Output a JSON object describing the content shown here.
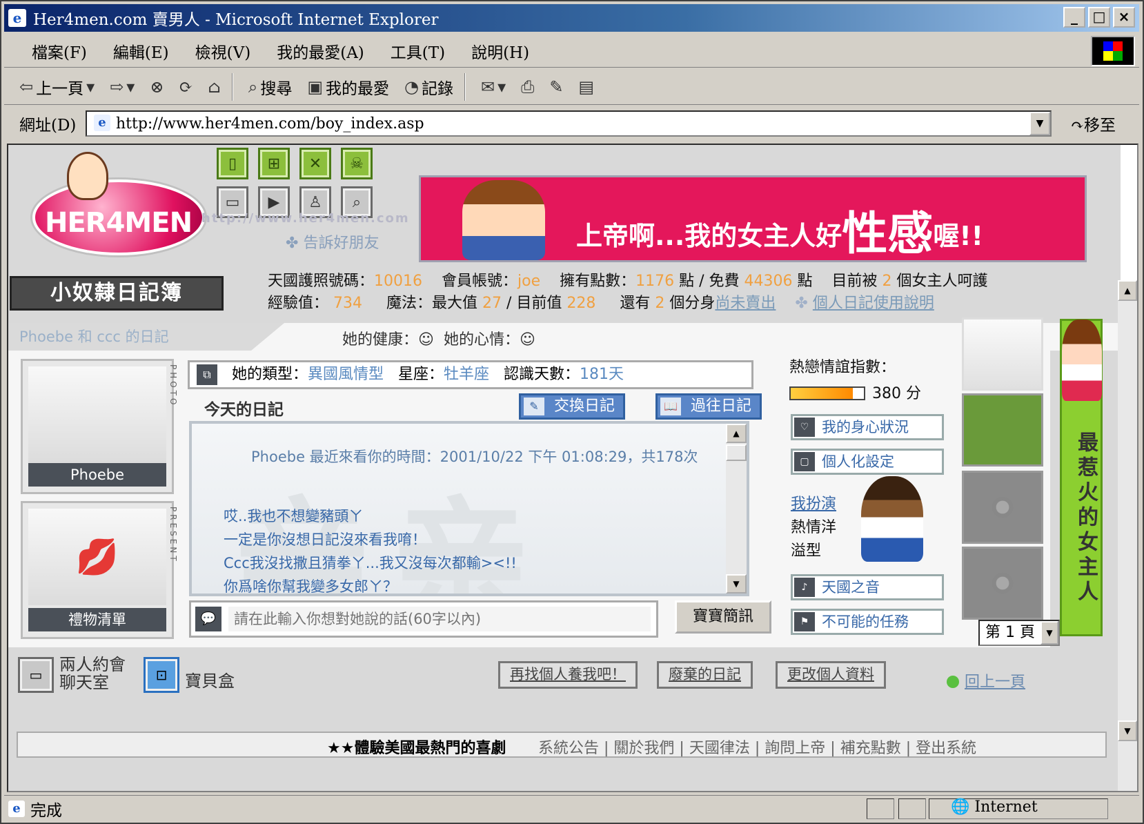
{
  "window": {
    "title": "Her4men.com 賣男人 - Microsoft Internet Explorer",
    "min": "_",
    "max": "□",
    "close": "×"
  },
  "menu": [
    "檔案(F)",
    "編輯(E)",
    "檢視(V)",
    "我的最愛(A)",
    "工具(T)",
    "說明(H)"
  ],
  "toolbar": {
    "back": "上一頁",
    "search": "搜尋",
    "favorites": "我的最愛",
    "history": "記錄"
  },
  "address": {
    "label": "網址(D)",
    "url": "http://www.her4men.com/boy_index.asp",
    "go": "移至"
  },
  "site": {
    "logo_text": "HER4MEN",
    "tell_friends": "告訴好朋友",
    "faded_url": "http://www.her4men.com",
    "banner_prefix": "上帝啊...我的女主人好",
    "banner_big": "性感",
    "banner_suffix": "喔!!",
    "diary_title": "小奴隸日記簿"
  },
  "stats": {
    "passport_label": "天國護照號碼：",
    "passport": "10016",
    "account_label": "會員帳號：",
    "account": "joe",
    "points_label": "擁有點數：",
    "points": "1176",
    "points_unit": "點 / 免費",
    "free_points": "44306",
    "free_unit": "點",
    "owned_prefix": "目前被",
    "owned_count": "2",
    "owned_suffix": "個女主人呵護",
    "exp_label": "經驗值：",
    "exp": "734",
    "magic_label": "魔法：最大值",
    "magic_max": "27",
    "magic_mid": "/ 目前值",
    "magic_cur": "228",
    "clones_prefix": "還有",
    "clones": "2",
    "clones_suffix": "個分身",
    "unsold": "尚未賣出",
    "help_link": "個人日記使用說明"
  },
  "subtitle": {
    "owner": "Phoebe 和 ccc 的日記",
    "health_label": "她的健康：",
    "mood_label": "她的心情："
  },
  "photo": {
    "name": "Phoebe",
    "photo_tag": "PHOTO",
    "present_tag": "PRESENT",
    "gift_list": "禮物清單"
  },
  "info": {
    "type_label": "她的類型：",
    "type": "異國風情型",
    "sign_label": "星座：",
    "sign": "牡羊座",
    "days_label": "認識天數：",
    "days": "181天"
  },
  "diary": {
    "today": "今天的日記",
    "exchange": "交換日記",
    "past": "過往日記",
    "header": "Phoebe 最近來看你的時間：2001/10/22 下午 01:08:29，共178次",
    "lines": [
      "哎..我也不想變豬頭ㄚ",
      "一定是你沒想日記沒來看我唷！",
      "Ccc我沒找撒且猜拳ㄚ...我又沒每次都輸><!!",
      "你爲啥你幫我變多女郎ㄚ？"
    ]
  },
  "message": {
    "placeholder": "請在此輸入你想對她說的話(60字以內)",
    "send": "寶寶簡訊"
  },
  "side": {
    "love_label": "熱戀情誼指數：",
    "love_score": "380 分",
    "love_level": 0.85,
    "health": "我的身心狀況",
    "settings": "個人化設定",
    "role_label": "我扮演",
    "role1": "熱情洋",
    "role2": "溢型",
    "voice": "天國之音",
    "mission": "不可能的任務"
  },
  "right": {
    "tag": "最惹火的女主人",
    "page": "第 1 頁"
  },
  "bottom": {
    "chat1": "兩人約會",
    "chat2": "聊天室",
    "box": "寶貝盒",
    "find": "再找個人養我吧！",
    "old": "廢棄的日記",
    "edit": "更改個人資料",
    "back": "回上一頁"
  },
  "footer": {
    "marquee": "★★體驗美國最熱門的喜劇",
    "links": [
      "系統公告",
      "關於我們",
      "天國律法",
      "詢問上帝",
      "補充點數",
      "登出系統"
    ]
  },
  "status": {
    "text": "完成",
    "zone": "Internet"
  }
}
